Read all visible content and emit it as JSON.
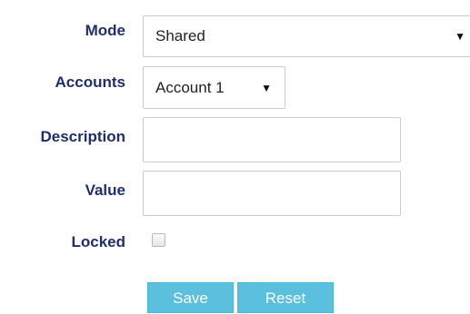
{
  "form": {
    "mode": {
      "label": "Mode",
      "selected": "Shared",
      "arrow": "▼"
    },
    "accounts": {
      "label": "Accounts",
      "selected": "Account 1",
      "arrow": "▼"
    },
    "description": {
      "label": "Description",
      "value": ""
    },
    "value": {
      "label": "Value",
      "value": ""
    },
    "locked": {
      "label": "Locked",
      "checked": false
    }
  },
  "actions": {
    "save_label": "Save",
    "reset_label": "Reset"
  },
  "colors": {
    "label_text": "#1f2f6e",
    "button_bg": "#5bc0de",
    "button_text": "#ffffff",
    "input_border": "#cccccc"
  }
}
